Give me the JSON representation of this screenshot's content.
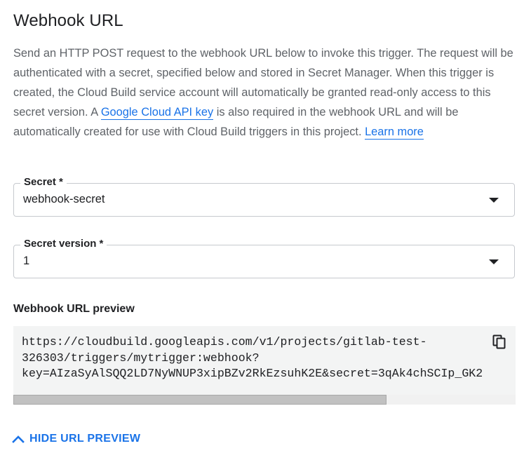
{
  "section": {
    "title": "Webhook URL",
    "description": {
      "part1": "Send an HTTP POST request to the webhook URL below to invoke this trigger. The request will be authenticated with a secret, specified below and stored in Secret Manager. When this trigger is created, the Cloud Build service account will automatically be granted read-only access to this secret version. A ",
      "link1": "Google Cloud API key",
      "part2": " is also required in the webhook URL and will be automatically created for use with Cloud Build triggers in this project. ",
      "link2": "Learn more"
    }
  },
  "secret": {
    "label": "Secret *",
    "value": "webhook-secret"
  },
  "secret_version": {
    "label": "Secret version *",
    "value": "1"
  },
  "preview": {
    "label": "Webhook URL preview",
    "url_text": "https://cloudbuild.googleapis.com/v1/projects/gitlab-test-\n326303/triggers/mytrigger:webhook?\nkey=AIzaSyAlSQQ2LD7NyWNUP3xipBZv2RkEzsuhK2E&secret=3qAk4chSCIp_GK2",
    "copy_icon": "copy-icon"
  },
  "toggle": {
    "label": "HIDE URL PREVIEW",
    "icon": "chevron-up-icon"
  },
  "colors": {
    "accent": "#1a73e8",
    "text": "#202124",
    "muted_text": "#5f6368",
    "preview_bg": "#f3f4f4"
  }
}
